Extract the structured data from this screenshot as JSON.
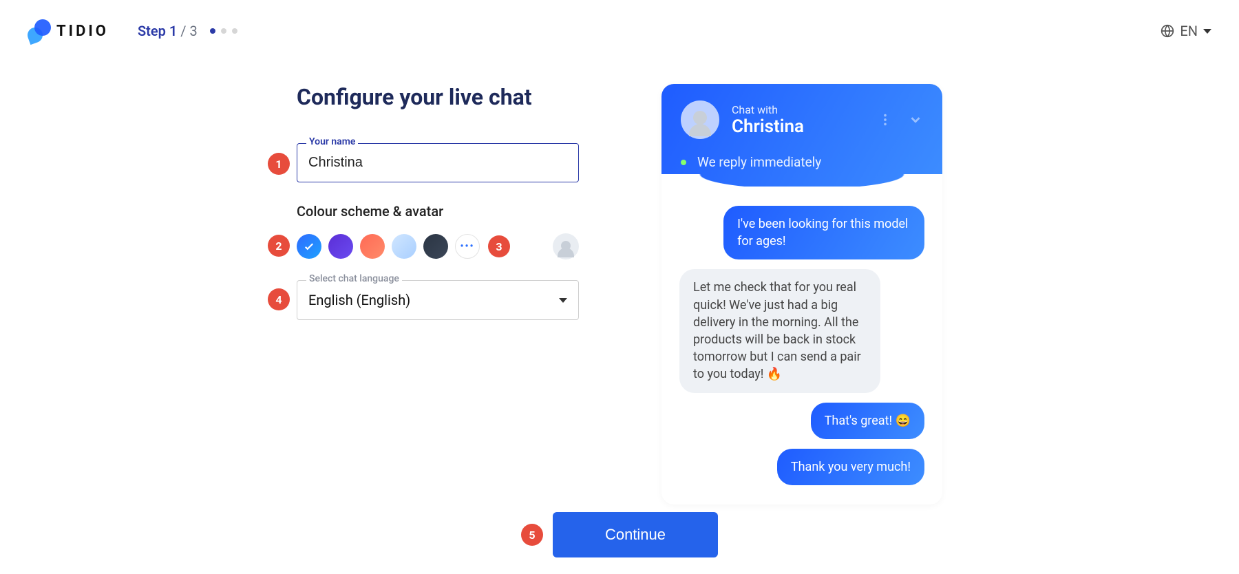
{
  "brand": {
    "word": "TIDIO"
  },
  "header": {
    "step_label": "Step 1",
    "step_total": "/ 3",
    "step_current": 1,
    "step_count": 3,
    "language_code": "EN"
  },
  "form": {
    "title": "Configure your live chat",
    "name_label": "Your name",
    "name_value": "Christina",
    "color_section": "Colour scheme & avatar",
    "colors": {
      "selected_index": 0,
      "options": [
        "blue-gradient",
        "purple",
        "coral",
        "sky",
        "navy"
      ],
      "more_label": "more-colors"
    },
    "language_label": "Select chat language",
    "language_value": "English (English)"
  },
  "preview": {
    "chat_with": "Chat with",
    "agent_name": "Christina",
    "reply_status": "We reply immediately",
    "messages": [
      {
        "side": "me",
        "text": "I've been looking for this model for ages!"
      },
      {
        "side": "them",
        "text": "Let me check that for you real quick! We've just had a big delivery in the morning. All the products will be back in stock tomorrow but I can send a pair to you today! 🔥"
      },
      {
        "side": "me",
        "text": "That's great! 😄"
      },
      {
        "side": "me",
        "text": "Thank you very much!"
      }
    ]
  },
  "footer": {
    "continue": "Continue"
  },
  "annotations": {
    "1": "1",
    "2": "2",
    "3": "3",
    "4": "4",
    "5": "5"
  }
}
